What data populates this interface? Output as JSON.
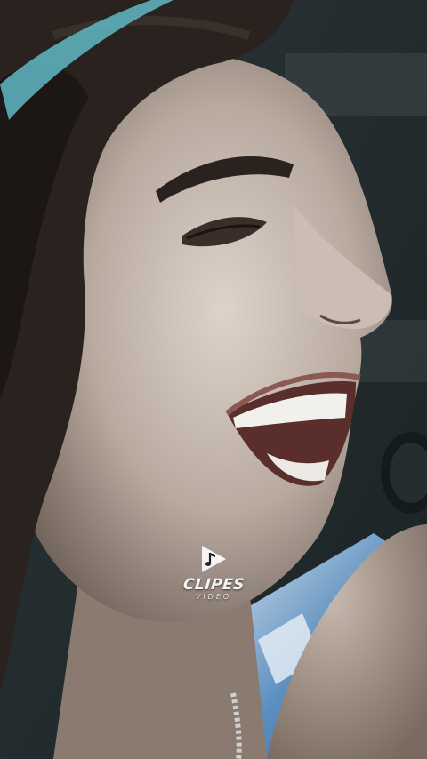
{
  "watermark": {
    "brand": "CLIPES",
    "sub": "VÍDEO",
    "icon": "play-music-note-icon"
  },
  "colors": {
    "background": "#1e2527",
    "skin_light": "#d9cfc7",
    "skin_shadow": "#7e6e64",
    "hair": "#2a221e",
    "shirt_blue": "#5b8fbf",
    "text": "#f4f4f4"
  }
}
